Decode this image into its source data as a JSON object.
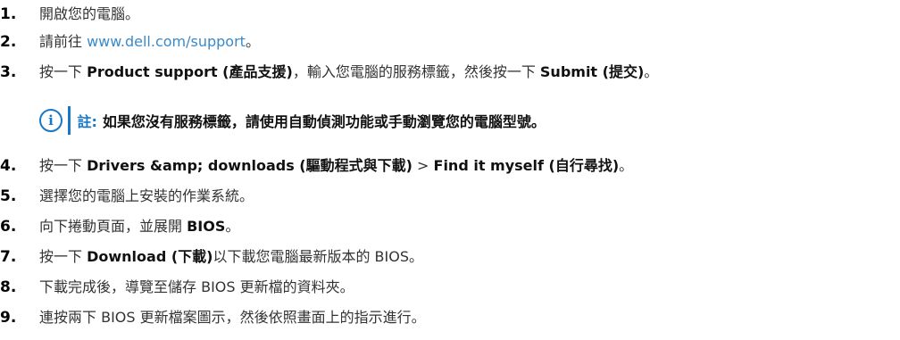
{
  "steps": [
    {
      "number": "1.",
      "parts": [
        "開啟您的電腦。"
      ]
    },
    {
      "number": "2.",
      "prefix": "請前往 ",
      "link": "www.dell.com/support",
      "suffix": "。"
    },
    {
      "number": "3.",
      "t1": "按一下 ",
      "b1": "Product support (產品支援)",
      "t2": "，輸入您電腦的服務標籤，然後按一下 ",
      "b2": "Submit (提交)",
      "t3": "。"
    },
    {
      "number": "4.",
      "t1": "按一下 ",
      "b1": "Drivers &amp; downloads (驅動程式與下載)",
      "t2": " > ",
      "b2": "Find it myself (自行尋找)",
      "t3": "。"
    },
    {
      "number": "5.",
      "text": "選擇您的電腦上安裝的作業系統。"
    },
    {
      "number": "6.",
      "t1": "向下捲動頁面，並展開 ",
      "b1": "BIOS",
      "t2": "。"
    },
    {
      "number": "7.",
      "t1": "按一下 ",
      "b1": "Download (下載)",
      "t2": "以下載您電腦最新版本的 BIOS。"
    },
    {
      "number": "8.",
      "text": "下載完成後，導覽至儲存 BIOS 更新檔的資料夾。"
    },
    {
      "number": "9.",
      "text": "連按兩下 BIOS 更新檔案圖示，然後依照畫面上的指示進行。"
    }
  ],
  "note": {
    "icon": "info-icon",
    "icon_glyph": "i",
    "label": "註:",
    "text": "如果您沒有服務標籤，請使用自動偵測功能或手動瀏覽您的電腦型號。"
  },
  "colors": {
    "accent": "#1978c6",
    "link": "#3a8ac9",
    "text": "#333333"
  }
}
